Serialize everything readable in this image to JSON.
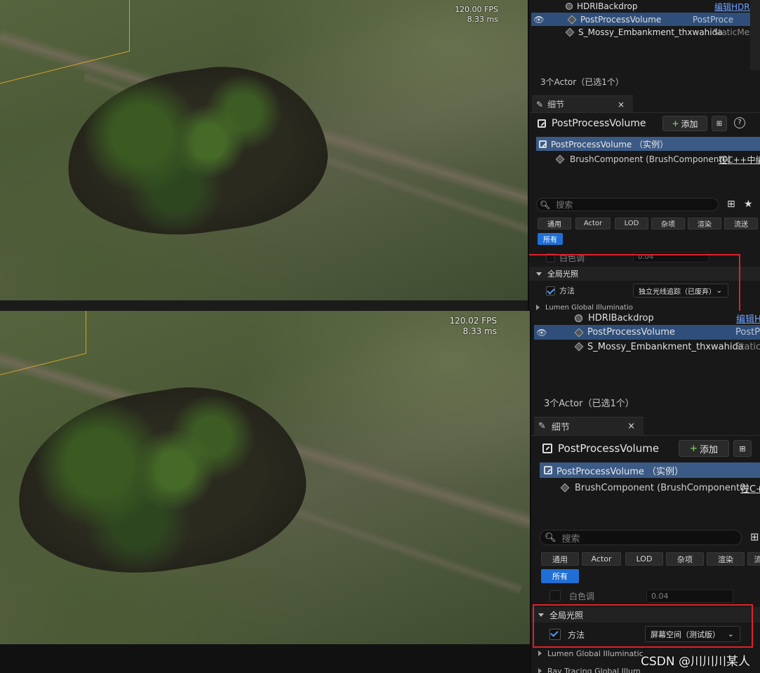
{
  "top": {
    "fps": "120.00 FPS",
    "ms": "8.33 ms",
    "outliner": [
      {
        "name": "HDRIBackdrop",
        "type": "编辑HDRIB",
        "type_link": true,
        "selected": false,
        "eye": false
      },
      {
        "name": "PostProcessVolume",
        "type": "PostProce",
        "type_link": false,
        "selected": true,
        "eye": true
      },
      {
        "name": "S_Mossy_Embankment_thxwahida",
        "type": "StaticMesh",
        "type_link": false,
        "selected": false,
        "eye": false
      }
    ],
    "actor_count": "3个Actor（已选1个）",
    "details_tab": "细节",
    "close_glyph": "×",
    "object_name": "PostProcessVolume",
    "add_label": "添加",
    "instance_label": "PostProcessVolume （实例）",
    "brush_component": "BrushComponent (BrushComponent0)",
    "cpp_link": "在C++中编",
    "search_placeholder": "搜索",
    "filters": [
      "通用",
      "Actor",
      "LOD",
      "杂项",
      "渲染",
      "流送"
    ],
    "filter_all": "所有",
    "prop_white_tone": "白色调",
    "white_tone_value": "0.04",
    "cat_gi": "全局光照",
    "prop_method": "方法",
    "method_value": "独立光线追踪（已废弃）",
    "lumen_gi": "Lumen Global Illuminatio"
  },
  "bottom": {
    "fps": "120.02 FPS",
    "ms": "8.33 ms",
    "outliner": [
      {
        "name": "HDRIBackdrop",
        "type": "编辑H",
        "type_link": true,
        "selected": false,
        "eye": false
      },
      {
        "name": "PostProcessVolume",
        "type": "PostPr",
        "type_link": false,
        "selected": true,
        "eye": true
      },
      {
        "name": "S_Mossy_Embankment_thxwahida",
        "type": "StaticM",
        "type_link": false,
        "selected": false,
        "eye": false
      }
    ],
    "actor_count": "3个Actor（已选1个）",
    "details_tab": "细节",
    "close_glyph": "×",
    "object_name": "PostProcessVolume",
    "add_label": "添加",
    "instance_label": "PostProcessVolume （实例）",
    "brush_component": "BrushComponent (BrushComponent0)",
    "cpp_link": "在C+",
    "search_placeholder": "搜索",
    "filters": [
      "通用",
      "Actor",
      "LOD",
      "杂项",
      "渲染",
      "流"
    ],
    "filter_all": "所有",
    "prop_white_tone": "白色调",
    "white_tone_value": "0.04",
    "cat_gi": "全局光照",
    "prop_method": "方法",
    "method_value": "屏幕空间（测试版）",
    "lumen_gi": "Lumen Global Illuminatic",
    "ray_tracing_gi": "Ray Tracing Global Illum"
  },
  "watermark": "CSDN @川川川某人",
  "colors": {
    "selection": "#2f4f7a",
    "highlight_box": "#e0202a",
    "link": "#6fa2ff",
    "filter_active": "#1f6fd6"
  }
}
